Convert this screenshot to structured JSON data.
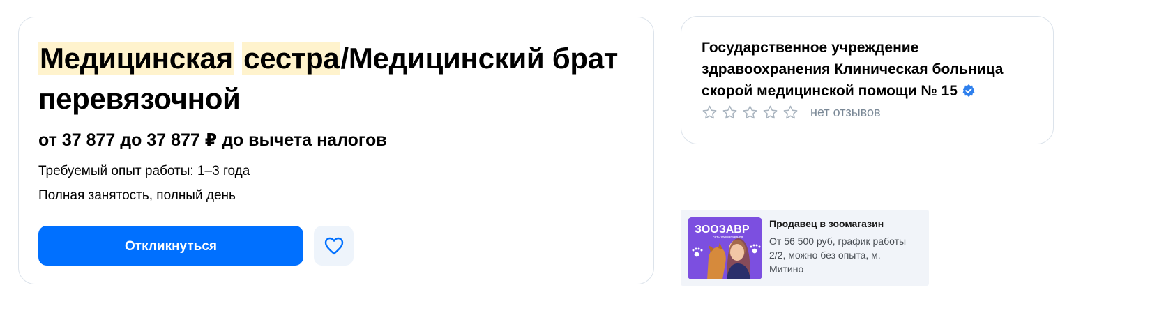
{
  "vacancy": {
    "title_highlight_1": "Медицинская",
    "title_sep": " ",
    "title_highlight_2": "сестра",
    "title_rest": "/Медицинский брат перевязочной",
    "salary": "от 37 877 до 37 877 ₽ до вычета налогов",
    "experience": "Требуемый опыт работы: 1–3 года",
    "employment": "Полная занятость, полный день",
    "respond_label": "Откликнуться",
    "highlight_color": "#fff3cd",
    "accent_color": "#0070ff"
  },
  "employer": {
    "name": "Государственное учреждение здравоохранения Клиническая больница скорой медицинской помощи № 15",
    "verified_icon": "verified-badge-icon",
    "rating_stars": 0,
    "rating_max": 5,
    "reviews_text": "нет отзывов"
  },
  "ad": {
    "logo_text": "ЗООЗАВР",
    "logo_subtext": "сеть зоомагазинов",
    "title": "Продавец в зоомагазин",
    "description": "От 56 500 руб, график работы 2/2, можно без опыта, м. Митино"
  }
}
